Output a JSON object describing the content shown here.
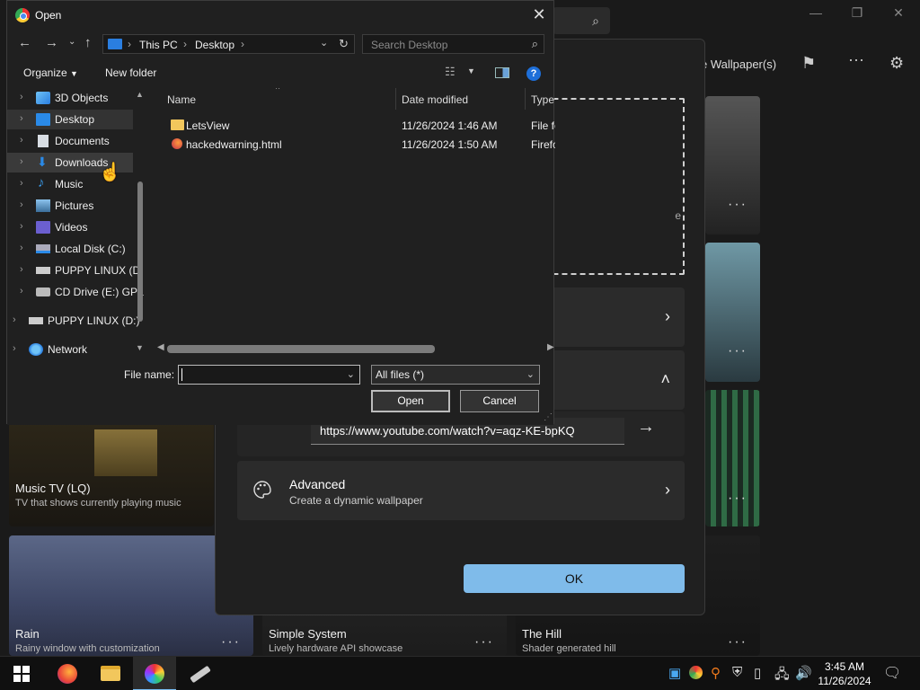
{
  "open_dialog": {
    "title": "Open",
    "address": {
      "segments": [
        "This PC",
        "Desktop"
      ]
    },
    "search_placeholder": "Search Desktop",
    "commands": {
      "organize": "Organize",
      "new_folder": "New folder"
    },
    "help": "?",
    "nav_tree": [
      {
        "label": "3D Objects",
        "icon": "cube-icon"
      },
      {
        "label": "Desktop",
        "icon": "desktop-icon",
        "selected": true
      },
      {
        "label": "Documents",
        "icon": "documents-icon"
      },
      {
        "label": "Downloads",
        "icon": "download-icon",
        "hovered": true
      },
      {
        "label": "Music",
        "icon": "music-icon"
      },
      {
        "label": "Pictures",
        "icon": "pictures-icon"
      },
      {
        "label": "Videos",
        "icon": "videos-icon"
      },
      {
        "label": "Local Disk (C:)",
        "icon": "drive-icon"
      },
      {
        "label": "PUPPY LINUX (D",
        "icon": "usb-drive-icon"
      },
      {
        "label": "CD Drive (E:) GPa",
        "icon": "cd-drive-icon"
      },
      {
        "label": "PUPPY LINUX (D:)",
        "icon": "usb-drive-icon"
      },
      {
        "label": "Network",
        "icon": "network-icon"
      }
    ],
    "columns": {
      "name": "Name",
      "date": "Date modified",
      "type": "Type"
    },
    "files": [
      {
        "name": "LetsView",
        "date": "11/26/2024 1:46 AM",
        "type": "File fo",
        "icon": "folder-icon"
      },
      {
        "name": "hackedwarning.html",
        "date": "11/26/2024 1:50 AM",
        "type": "Firefo",
        "icon": "firefox-file-icon"
      }
    ],
    "file_name_label": "File name:",
    "file_name_value": "",
    "filter_value": "All files (*)",
    "open_button": "Open",
    "cancel_button": "Cancel"
  },
  "add_wallpaper": {
    "dropzone_text": "e",
    "url_value": "https://www.youtube.com/watch?v=aqz-KE-bpKQ",
    "advanced_title": "Advanced",
    "advanced_subtitle": "Create a dynamic wallpaper",
    "ok_button": "OK"
  },
  "app": {
    "toolbar_text": "e Wallpaper(s)",
    "tiles": [
      {
        "title": "Music TV (LQ)",
        "desc": "TV that shows currently playing music"
      },
      {
        "title": "Rain",
        "desc": "Rainy window with customization"
      },
      {
        "title": "Simple System",
        "desc": "Lively hardware API showcase"
      },
      {
        "title": "The Hill",
        "desc": "Shader generated hill"
      }
    ]
  },
  "taskbar": {
    "time": "3:45 AM",
    "date": "11/26/2024"
  },
  "colors": {
    "accent": "#76b9ed",
    "ok_button": "#7fbbea",
    "dialog_bg": "#202020"
  }
}
